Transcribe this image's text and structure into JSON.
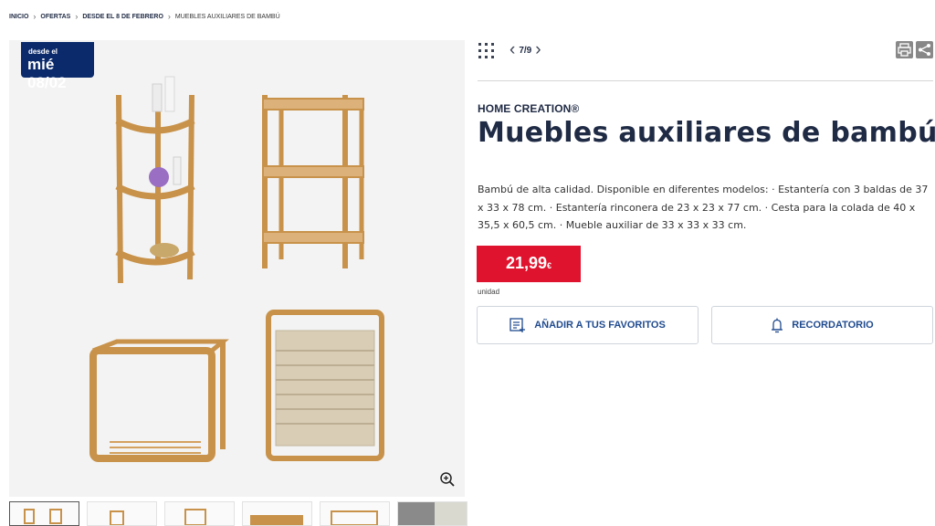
{
  "breadcrumb": {
    "items": [
      "INICIO",
      "OFERTAS",
      "DESDE EL 8 DE FEBRERO",
      "MUEBLES AUXILIARES DE BAMBÚ"
    ],
    "separator": "›"
  },
  "badge": {
    "line1": "desde el",
    "line2": "mié 08/02",
    "color": "#0a2a6b"
  },
  "gallery": {
    "products": [
      "corner-shelf",
      "three-tier-shelf",
      "cube-stool",
      "laundry-basket"
    ],
    "zoom_icon": "zoom-in-icon",
    "thumbnail_count": 6,
    "active_thumbnail": 1
  },
  "nav": {
    "pager_text": "7/9",
    "prev_icon": "chevron-left-icon",
    "next_icon": "chevron-right-icon",
    "grid_icon": "grid-icon",
    "print_icon": "print-icon",
    "share_icon": "share-icon"
  },
  "product": {
    "brand": "HOME CREATION®",
    "title": "Muebles auxiliares de bambú",
    "description": "Bambú de alta calidad. Disponible en diferentes modelos: · Estantería con 3 baldas de 37 x 33 x 78 cm. · Estantería rinconera de 23 x 23 x 77 cm. · Cesta para la colada de 40 x 35,5 x 60,5 cm. · Mueble auxiliar de 33 x 33 x 33 cm.",
    "price_main": "21,99",
    "price_currency": "€",
    "unit": "unidad",
    "price_color": "#e0132e"
  },
  "actions": {
    "favorites_label": "AÑADIR A TUS FAVORITOS",
    "favorites_icon": "list-add-icon",
    "reminder_label": "RECORDATORIO",
    "reminder_icon": "bell-icon",
    "accent_color": "#1f4a8e"
  }
}
